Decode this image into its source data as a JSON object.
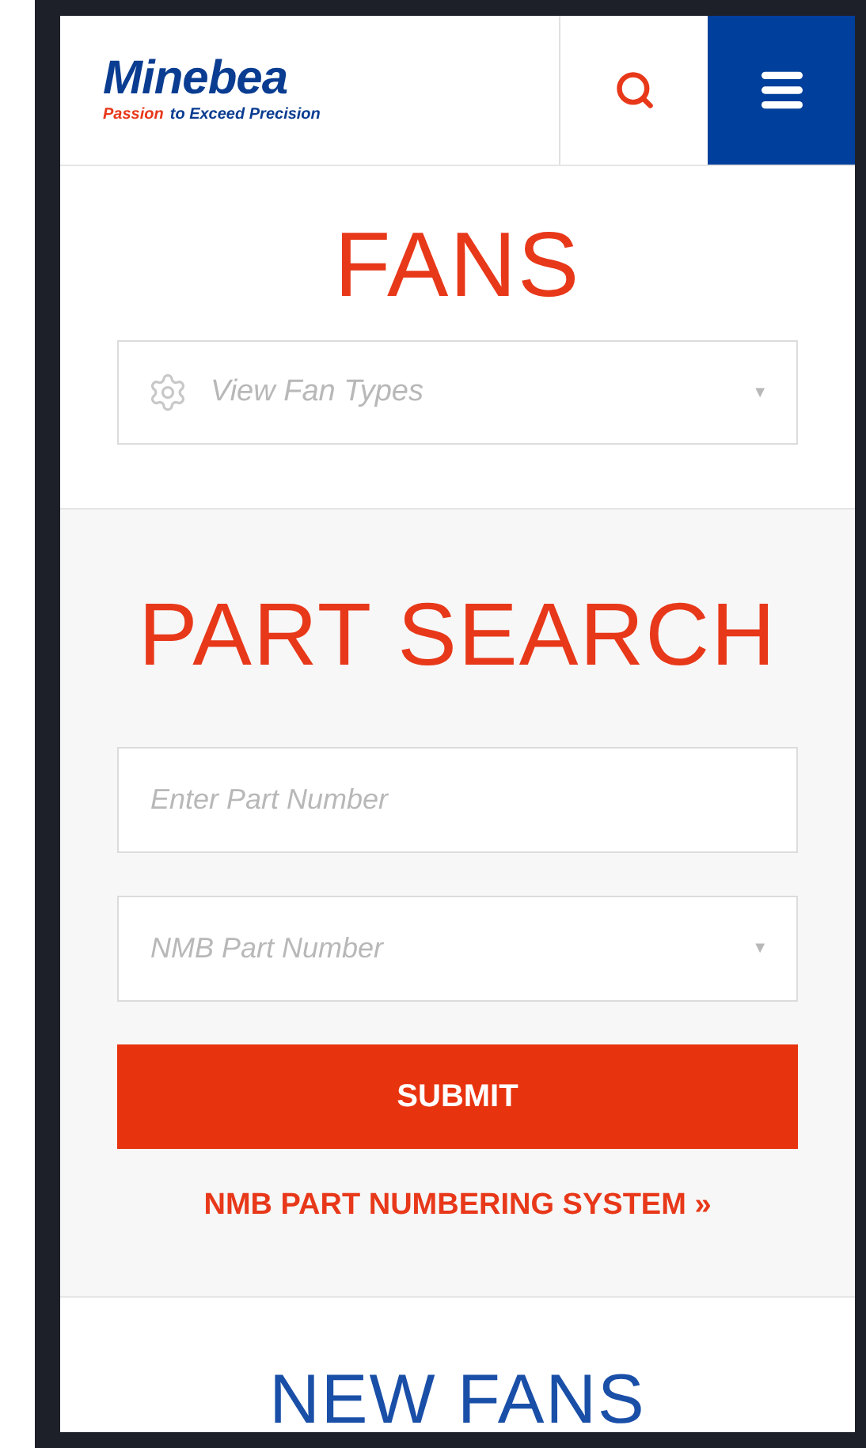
{
  "header": {
    "logo": "Minebea",
    "tagline_lead": "Passion",
    "tagline_rest": "to Exceed Precision"
  },
  "fans": {
    "title": "FANS",
    "dropdown": {
      "placeholder": "View Fan Types",
      "caret": "▼"
    }
  },
  "part_search": {
    "title": "PART SEARCH",
    "fields": [
      {
        "kind": "input",
        "placeholder": "Enter Part Number"
      },
      {
        "kind": "select",
        "placeholder": "NMB Part Number",
        "caret": "▼"
      }
    ],
    "submit": "SUBMIT",
    "link": "NMB PART NUMBERING SYSTEM »"
  },
  "new_fans": {
    "title": "NEW FANS"
  }
}
